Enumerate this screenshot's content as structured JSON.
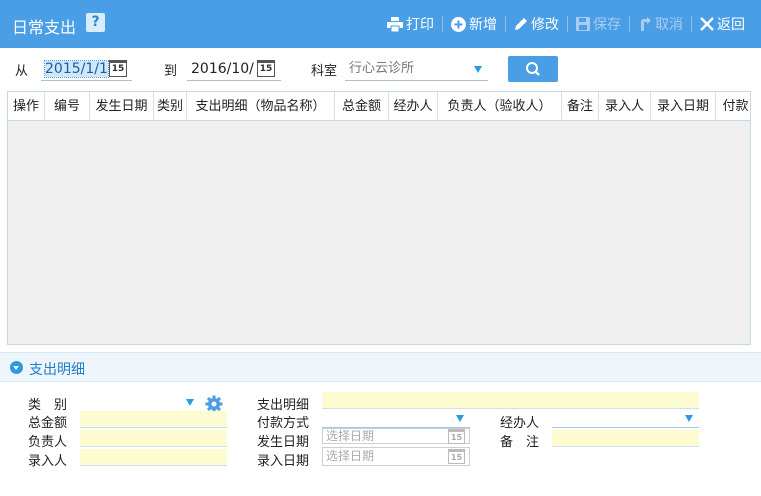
{
  "title": "日常支出",
  "help_label": "?",
  "toolbar": {
    "print": "打印",
    "add": "新增",
    "edit": "修改",
    "save": "保存",
    "cancel": "取消",
    "back": "返回"
  },
  "filter": {
    "from_label": "从",
    "from_value": "2015/1/1",
    "to_label": "到",
    "to_value": "2016/10/",
    "dept_label": "科室",
    "dept_value": "行心云诊所",
    "calendar_day": "15"
  },
  "table": {
    "columns": [
      "操作",
      "编号",
      "发生日期",
      "类别",
      "支出明细（物品名称）",
      "总金额",
      "经办人",
      "负责人（验收人）",
      "备注",
      "录入人",
      "录入日期",
      "付款"
    ]
  },
  "section": {
    "title": "支出明细"
  },
  "form": {
    "category_label": "类　别",
    "total_label": "总金额",
    "owner_label": "负责人",
    "entered_by_label": "录入人",
    "detail_label": "支出明细",
    "payment_label": "付款方式",
    "date_label": "发生日期",
    "entry_date_label": "录入日期",
    "handler_label": "经办人",
    "remark_label": "备　注",
    "date_placeholder": "选择日期",
    "entry_date_placeholder": "选择日期"
  },
  "colors": {
    "titlebar": "#4a9ee6",
    "accent": "#2a9be0",
    "field_highlight": "#fdfbd0",
    "grid_bg": "#efefef"
  }
}
